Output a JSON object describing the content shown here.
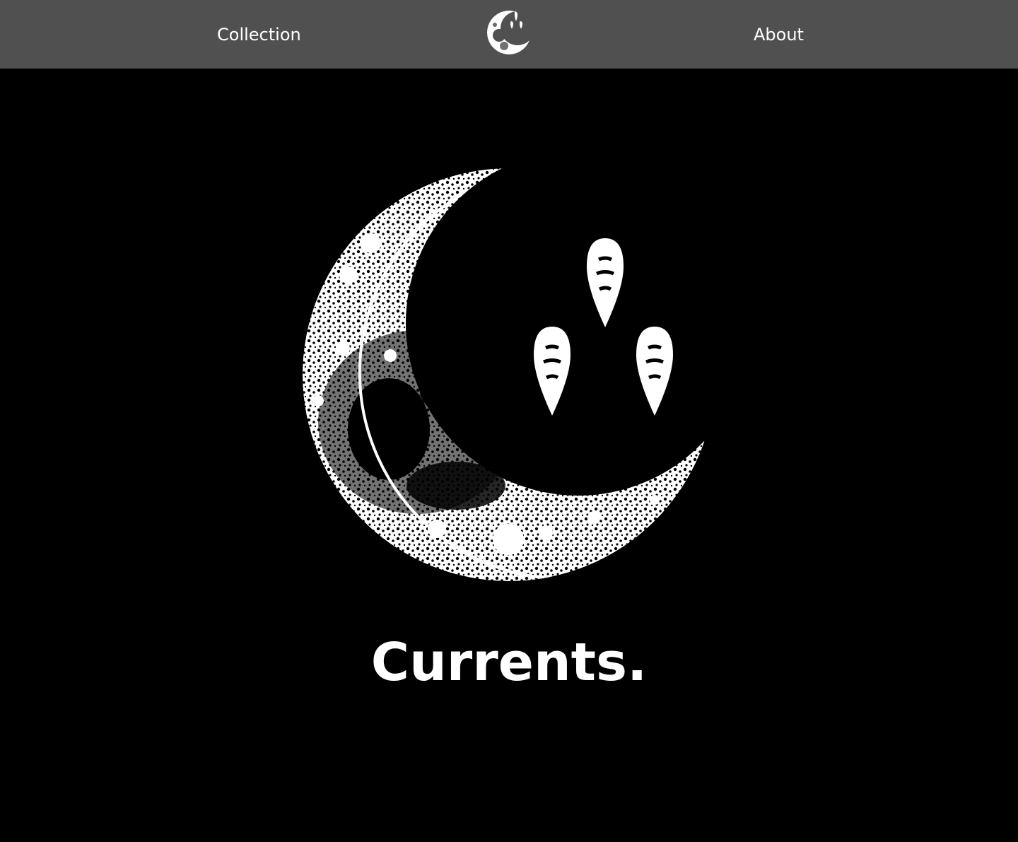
{
  "header": {
    "background": "#505050",
    "nav_left_label": "Collection",
    "nav_right_label": "About",
    "logo_icon": "crescent-skull-moon-icon"
  },
  "hero": {
    "artwork_icon": "crescent-skull-moon-with-drops-icon",
    "title": "Currents."
  },
  "colors": {
    "page_background": "#000000",
    "text": "#ffffff"
  }
}
